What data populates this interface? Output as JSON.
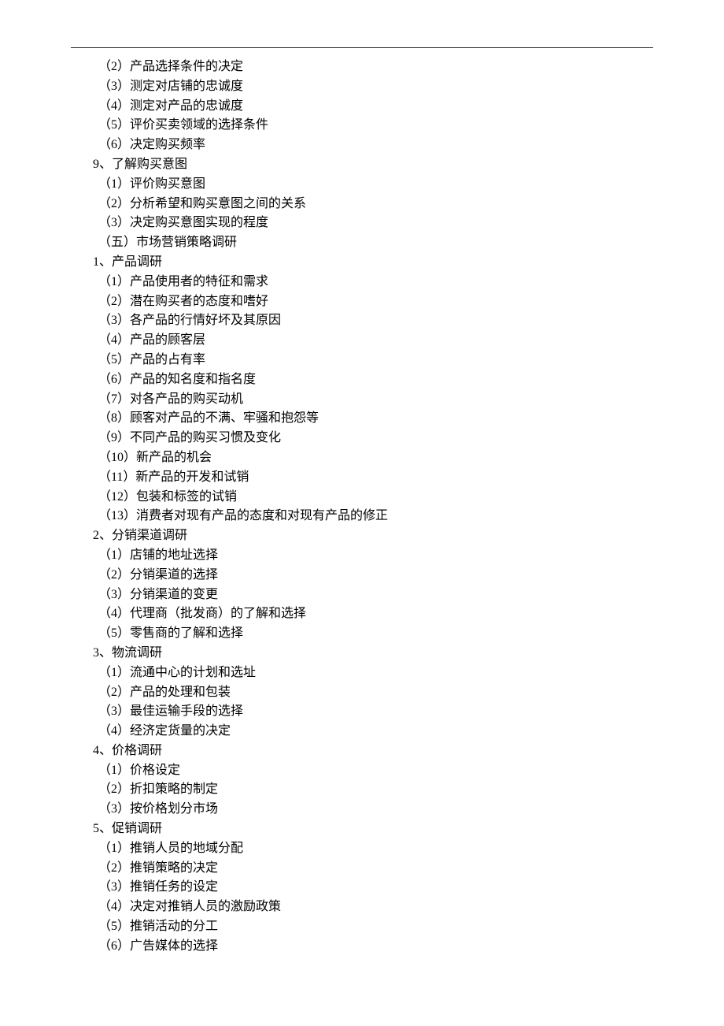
{
  "lines": [
    {
      "cls": "l1",
      "text": "（2）产品选择条件的决定"
    },
    {
      "cls": "l1",
      "text": "（3）测定对店铺的忠诚度"
    },
    {
      "cls": "l1",
      "text": "（4）测定对产品的忠诚度"
    },
    {
      "cls": "l1",
      "text": "（5）评价买卖领域的选择条件"
    },
    {
      "cls": "l1",
      "text": "（6）决定购买频率"
    },
    {
      "cls": "l0",
      "text": "9、了解购买意图"
    },
    {
      "cls": "l1",
      "text": "（1）评价购买意图"
    },
    {
      "cls": "l1",
      "text": "（2）分析希望和购买意图之间的关系"
    },
    {
      "cls": "l1",
      "text": "（3）决定购买意图实现的程度"
    },
    {
      "cls": "l1",
      "text": "（五）市场营销策略调研"
    },
    {
      "cls": "l0",
      "text": "1、产品调研"
    },
    {
      "cls": "l1",
      "text": "（1）产品使用者的特征和需求"
    },
    {
      "cls": "l1",
      "text": "（2）潜在购买者的态度和嗜好"
    },
    {
      "cls": "l1",
      "text": "（3）各产品的行情好坏及其原因"
    },
    {
      "cls": "l1",
      "text": "（4）产品的顾客层"
    },
    {
      "cls": "l1",
      "text": "（5）产品的占有率"
    },
    {
      "cls": "l1",
      "text": "（6）产品的知名度和指名度"
    },
    {
      "cls": "l1",
      "text": "（7）对各产品的购买动机"
    },
    {
      "cls": "l1",
      "text": "（8）顾客对产品的不满、牢骚和抱怨等"
    },
    {
      "cls": "l1",
      "text": "（9）不同产品的购买习惯及变化"
    },
    {
      "cls": "l1",
      "text": "（10）新产品的机会"
    },
    {
      "cls": "l1",
      "text": "（11）新产品的开发和试销"
    },
    {
      "cls": "l1",
      "text": "（12）包装和标签的试销"
    },
    {
      "cls": "l1",
      "text": "（13）消费者对现有产品的态度和对现有产品的修正"
    },
    {
      "cls": "l0",
      "text": "2、分销渠道调研"
    },
    {
      "cls": "l1",
      "text": "（1）店铺的地址选择"
    },
    {
      "cls": "l1",
      "text": "（2）分销渠道的选择"
    },
    {
      "cls": "l1",
      "text": "（3）分销渠道的变更"
    },
    {
      "cls": "l1",
      "text": "（4）代理商（批发商）的了解和选择"
    },
    {
      "cls": "l1",
      "text": "（5）零售商的了解和选择"
    },
    {
      "cls": "l0",
      "text": "3、物流调研"
    },
    {
      "cls": "l1",
      "text": "（1）流通中心的计划和选址"
    },
    {
      "cls": "l1",
      "text": "（2）产品的处理和包装"
    },
    {
      "cls": "l1",
      "text": "（3）最佳运输手段的选择"
    },
    {
      "cls": "l1",
      "text": "（4）经济定货量的决定"
    },
    {
      "cls": "l0",
      "text": "4、价格调研"
    },
    {
      "cls": "l1",
      "text": "（1）价格设定"
    },
    {
      "cls": "l1",
      "text": "（2）折扣策略的制定"
    },
    {
      "cls": "l1",
      "text": "（3）按价格划分市场"
    },
    {
      "cls": "l0",
      "text": "5、促销调研"
    },
    {
      "cls": "l1",
      "text": "（1）推销人员的地域分配"
    },
    {
      "cls": "l1",
      "text": "（2）推销策略的决定"
    },
    {
      "cls": "l1",
      "text": "（3）推销任务的设定"
    },
    {
      "cls": "l1",
      "text": "（4）决定对推销人员的激励政策"
    },
    {
      "cls": "l1",
      "text": "（5）推销活动的分工"
    },
    {
      "cls": "l1",
      "text": "（6）广告媒体的选择"
    }
  ]
}
